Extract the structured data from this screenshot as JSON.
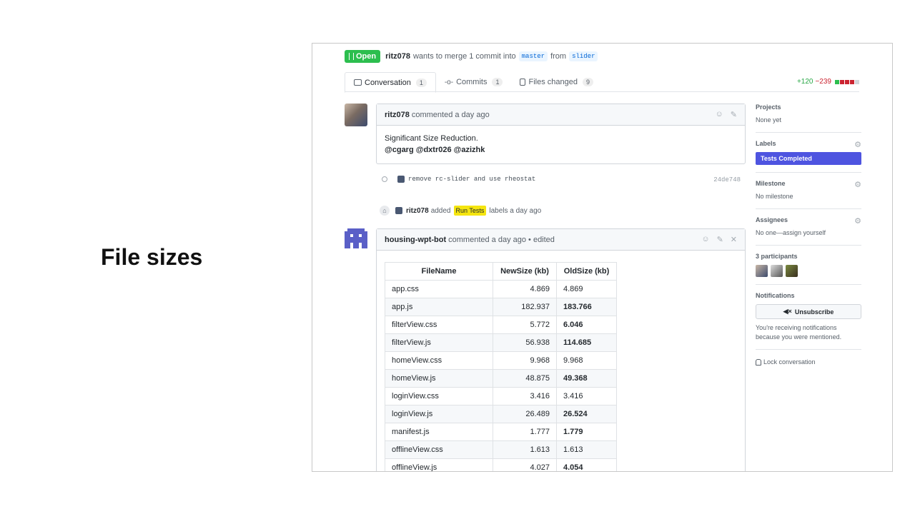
{
  "slide": {
    "title": "File sizes"
  },
  "pr": {
    "state": "Open",
    "author": "ritz078",
    "summary_pre": "wants to merge 1 commit into",
    "base": "master",
    "from_word": "from",
    "head": "slider",
    "tabs": [
      {
        "label": "Conversation",
        "count": "1"
      },
      {
        "label": "Commits",
        "count": "1"
      },
      {
        "label": "Files changed",
        "count": "9"
      }
    ],
    "diff_add": "+120",
    "diff_del": "−239"
  },
  "comment1": {
    "author": "ritz078",
    "meta": "commented a day ago",
    "body_line1": "Significant Size Reduction.",
    "mentions": "@cgarg @dxtr026 @azizhk"
  },
  "commit_event": {
    "message": "remove rc-slider and use rheostat",
    "sha": "24de748"
  },
  "label_event": {
    "actor": "ritz078",
    "action": "added",
    "label": "Run Tests",
    "suffix": "labels a day ago"
  },
  "comment2": {
    "author": "housing-wpt-bot",
    "meta": "commented a day ago • edited",
    "table": {
      "headers": [
        "FileName",
        "NewSize (kb)",
        "OldSize (kb)"
      ],
      "rows": [
        {
          "name": "app.css",
          "new": "4.869",
          "old": "4.869",
          "old_bold": false
        },
        {
          "name": "app.js",
          "new": "182.937",
          "old": "183.766",
          "old_bold": true
        },
        {
          "name": "filterView.css",
          "new": "5.772",
          "old": "6.046",
          "old_bold": true
        },
        {
          "name": "filterView.js",
          "new": "56.938",
          "old": "114.685",
          "old_bold": true
        },
        {
          "name": "homeView.css",
          "new": "9.968",
          "old": "9.968",
          "old_bold": false
        },
        {
          "name": "homeView.js",
          "new": "48.875",
          "old": "49.368",
          "old_bold": true
        },
        {
          "name": "loginView.css",
          "new": "3.416",
          "old": "3.416",
          "old_bold": false
        },
        {
          "name": "loginView.js",
          "new": "26.489",
          "old": "26.524",
          "old_bold": true
        },
        {
          "name": "manifest.js",
          "new": "1.777",
          "old": "1.779",
          "old_bold": true
        },
        {
          "name": "offlineView.css",
          "new": "1.613",
          "old": "1.613",
          "old_bold": false
        },
        {
          "name": "offlineView.js",
          "new": "4.027",
          "old": "4.054",
          "old_bold": true
        }
      ]
    }
  },
  "sidebar": {
    "projects_h": "Projects",
    "projects_v": "None yet",
    "labels_h": "Labels",
    "label_value": "Tests Completed",
    "label_color": "#4e54e0",
    "milestone_h": "Milestone",
    "milestone_v": "No milestone",
    "assignees_h": "Assignees",
    "assignees_v": "No one—assign yourself",
    "participants_h": "3 participants",
    "notifications_h": "Notifications",
    "unsubscribe": "Unsubscribe",
    "notif_text": "You're receiving notifications because you were mentioned.",
    "lock": "Lock conversation"
  }
}
